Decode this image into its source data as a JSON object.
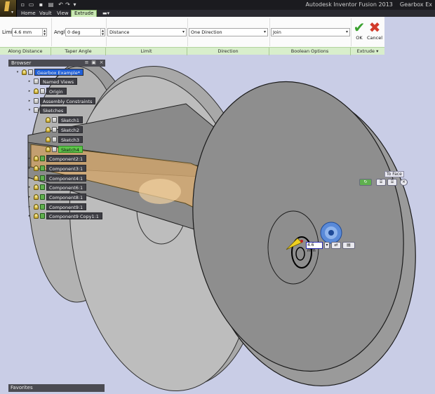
{
  "window": {
    "app_title": "Autodesk Inventor Fusion 2013",
    "doc_title": "Gearbox Ex"
  },
  "tabs": [
    "Home",
    "Vault",
    "View",
    "Extrude"
  ],
  "active_tab": "Extrude",
  "ribbon": {
    "limit_label": "Limit",
    "limit_value": "4.6 mm",
    "angle_label": "Angle",
    "angle_value": "0 deg",
    "extent_type": "Distance",
    "direction": "One Direction",
    "boolean": "Join",
    "ok_label": "OK",
    "cancel_label": "Cancel",
    "panels": [
      "Along Distance",
      "Taper Angle",
      "Limit",
      "Direction",
      "Boolean Options",
      "Extrude"
    ]
  },
  "browser": {
    "title": "Browser",
    "root": "Gearbox Example*",
    "folders": [
      "Named Views",
      "Origin",
      "Assembly Constraints",
      "Sketches"
    ],
    "sketches": [
      "Sketch1",
      "Sketch2",
      "Sketch3",
      "Sketch4"
    ],
    "components": [
      "Component2:1",
      "Component3:1",
      "Component4:1",
      "Component6:1",
      "Component8:1",
      "Component9:1",
      "Component9 Copy1:1"
    ]
  },
  "favorites": {
    "title": "Favorites"
  },
  "minitoolbar": {
    "distance_value": "4.6 mm",
    "to_face_label": "To Face"
  },
  "colors": {
    "viewport_bg": "#c9cde6",
    "ribbon_panel_strip": "#d8eecb",
    "active_tab": "#c9e8b4",
    "profile_fill": "#e0b072",
    "ok_green": "#3aa12e",
    "cancel_red": "#d23a2a"
  }
}
